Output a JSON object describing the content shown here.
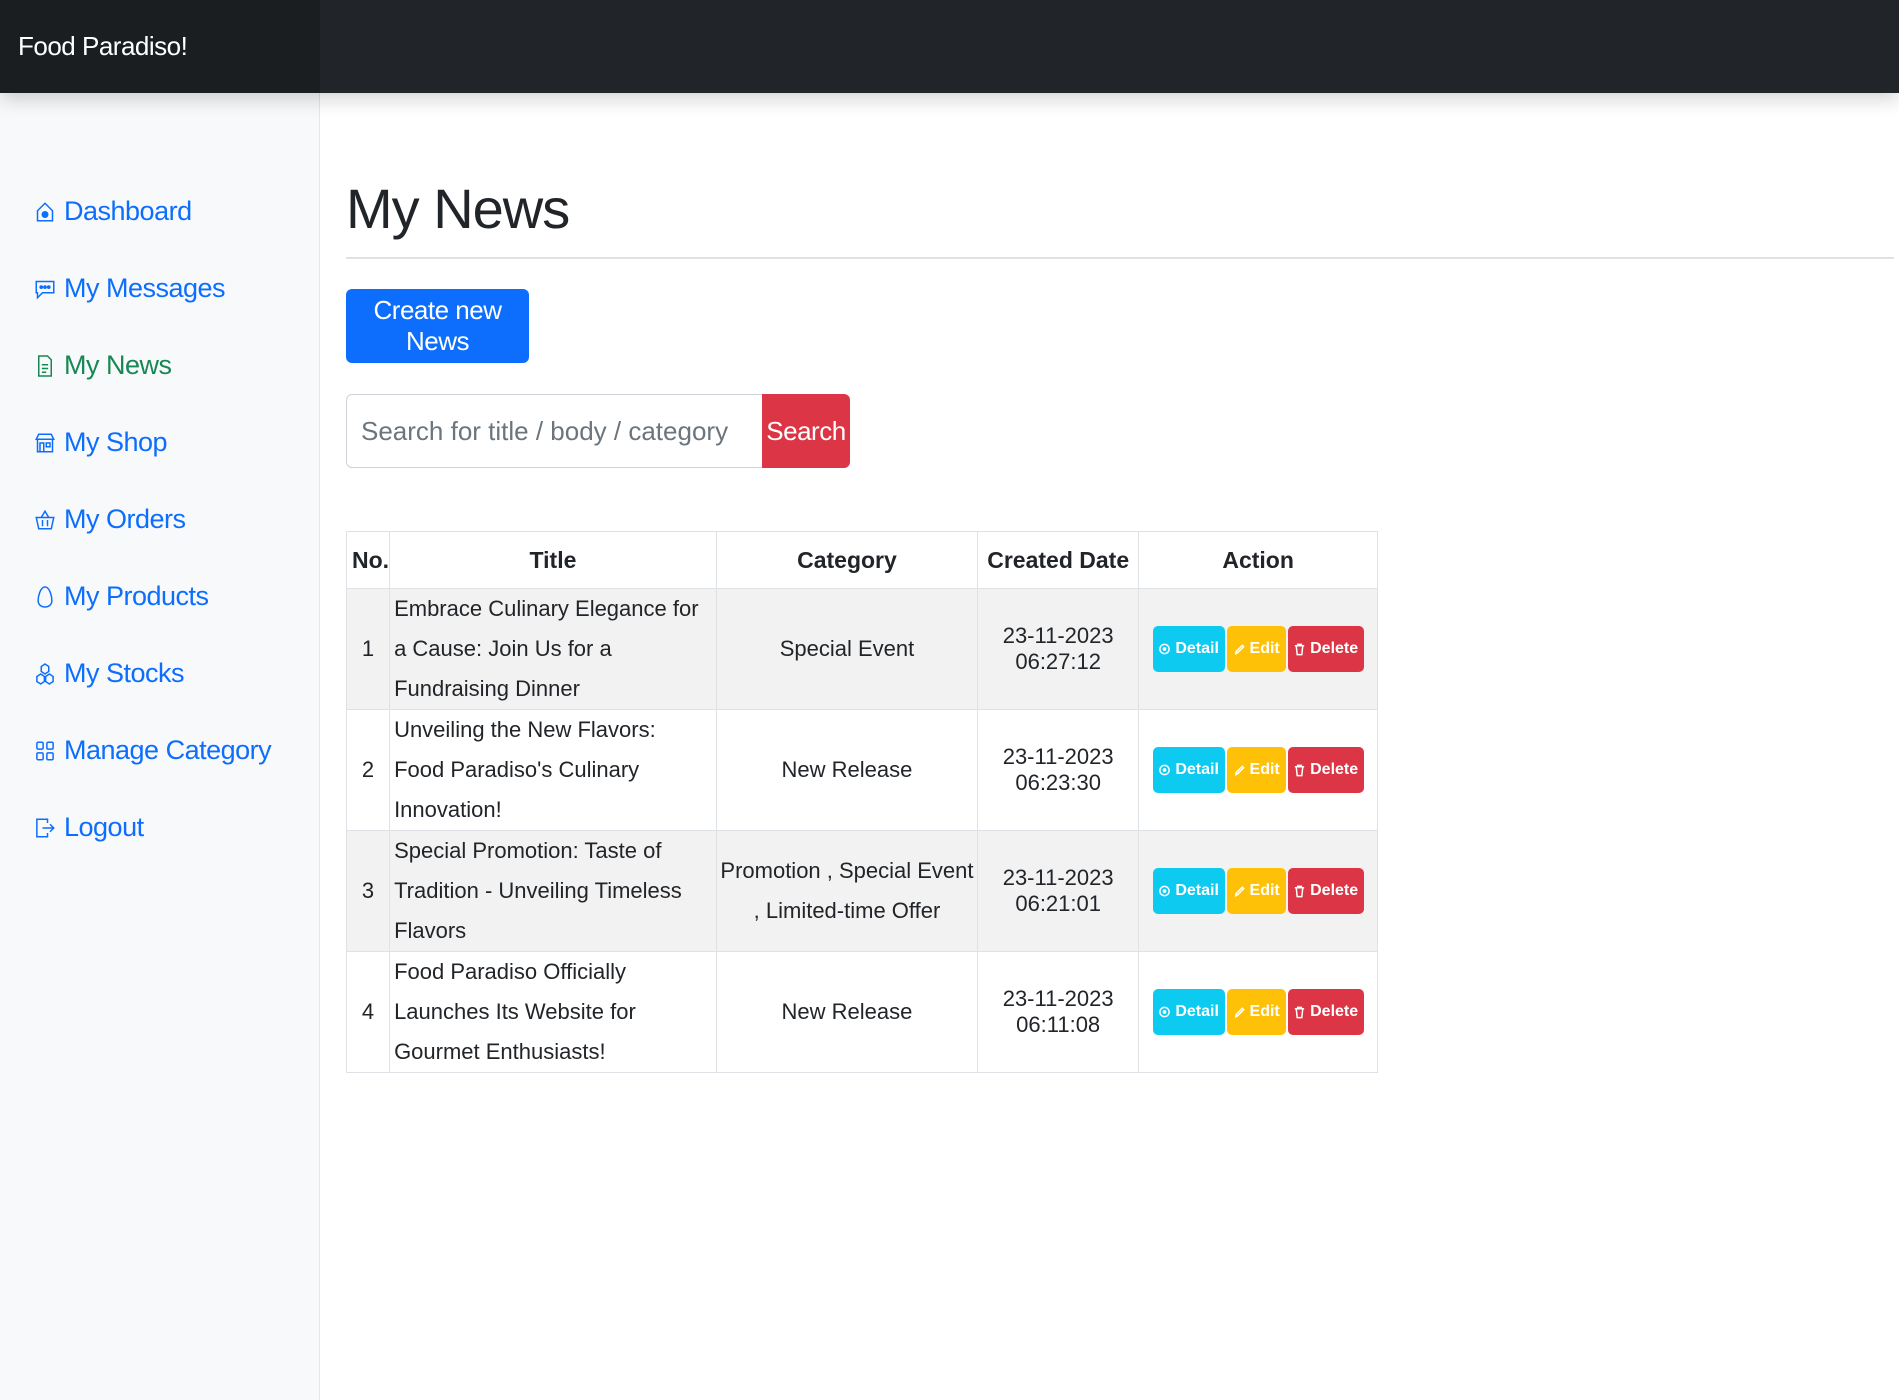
{
  "app": {
    "brand": "Food Paradiso!"
  },
  "sidebar": {
    "items": [
      {
        "label": "Dashboard",
        "icon": "house-gear-icon",
        "active": false
      },
      {
        "label": "My Messages",
        "icon": "chat-dots-icon",
        "active": false
      },
      {
        "label": "My News",
        "icon": "file-text-icon",
        "active": true
      },
      {
        "label": "My Shop",
        "icon": "shop-icon",
        "active": false
      },
      {
        "label": "My Orders",
        "icon": "basket-icon",
        "active": false
      },
      {
        "label": "My Products",
        "icon": "egg-icon",
        "active": false
      },
      {
        "label": "My Stocks",
        "icon": "boxes-icon",
        "active": false
      },
      {
        "label": "Manage Category",
        "icon": "grid-icon",
        "active": false
      },
      {
        "label": "Logout",
        "icon": "box-arrow-right-icon",
        "active": false
      }
    ]
  },
  "main": {
    "title": "My News",
    "create_button": "Create new News",
    "search": {
      "placeholder": "Search for title / body / category",
      "value": "",
      "button": "Search"
    },
    "table": {
      "headers": [
        "No.",
        "Title",
        "Category",
        "Created Date",
        "Action"
      ],
      "rows": [
        {
          "no": "1",
          "title": "Embrace Culinary Elegance for a Cause: Join Us for a Fundraising Dinner",
          "category": "Special Event",
          "date": "23-11-2023 06:27:12"
        },
        {
          "no": "2",
          "title": "Unveiling the New Flavors: Food Paradiso's Culinary Innovation!",
          "category": "New Release",
          "date": "23-11-2023 06:23:30"
        },
        {
          "no": "3",
          "title": "Special Promotion: Taste of Tradition - Unveiling Timeless Flavors",
          "category": "Promotion , Special Event , Limited-time Offer",
          "date": "23-11-2023 06:21:01"
        },
        {
          "no": "4",
          "title": "Food Paradiso Officially Launches Its Website for Gourmet Enthusiasts!",
          "category": "New Release",
          "date": "23-11-2023 06:11:08"
        }
      ],
      "actions": {
        "detail": "Detail",
        "edit": "Edit",
        "delete": "Delete"
      }
    }
  },
  "colors": {
    "topbar": "#212529",
    "link": "#0d6efd",
    "active": "#198754",
    "danger": "#dc3545",
    "info": "#0dcaf0",
    "warning": "#ffc107"
  }
}
